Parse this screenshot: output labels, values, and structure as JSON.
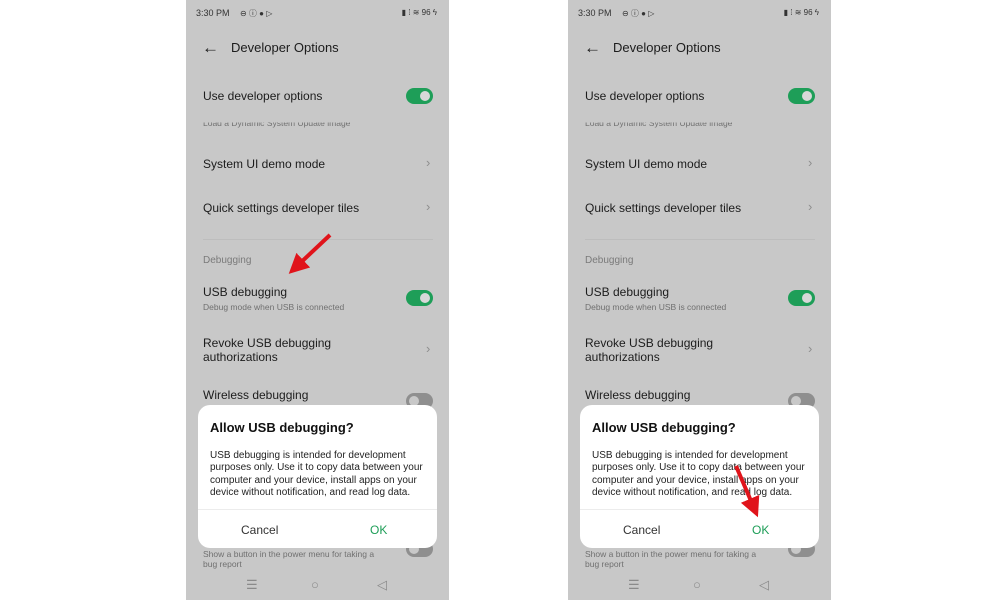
{
  "status_bar": {
    "time": "3:30 PM",
    "left_icons": "⊖ ⓘ ● ▷",
    "right_icons": "▮ ⁞ ≋ 96 ϟ",
    "battery": "96"
  },
  "header": {
    "title": "Developer Options",
    "back_icon": "arrow-left"
  },
  "settings": {
    "use_dev_options": "Use developer options",
    "partial_text": "Load a Dynamic System Update image",
    "system_ui_demo": "System UI demo mode",
    "quick_settings_tiles": "Quick settings developer tiles",
    "section_debugging": "Debugging",
    "usb_debugging": "USB debugging",
    "usb_debugging_sub": "Debug mode when USB is connected",
    "revoke_line1": "Revoke USB debugging",
    "revoke_line2": "authorizations",
    "wireless_debugging": "Wireless debugging",
    "bug_report_sub": "Show a button in the power menu for taking a",
    "bug_report_sub2": "bug report"
  },
  "dialog": {
    "title": "Allow USB debugging?",
    "body": "USB debugging is intended for development purposes only. Use it to copy data between your computer and your device, install apps on your device without notification, and read log data.",
    "cancel": "Cancel",
    "ok": "OK"
  },
  "nav": {
    "menu": "☰",
    "home": "○",
    "back": "◁"
  },
  "colors": {
    "accent": "#1e9e58",
    "arrow": "#e0141b",
    "screen_bg": "#c8c8c8"
  }
}
